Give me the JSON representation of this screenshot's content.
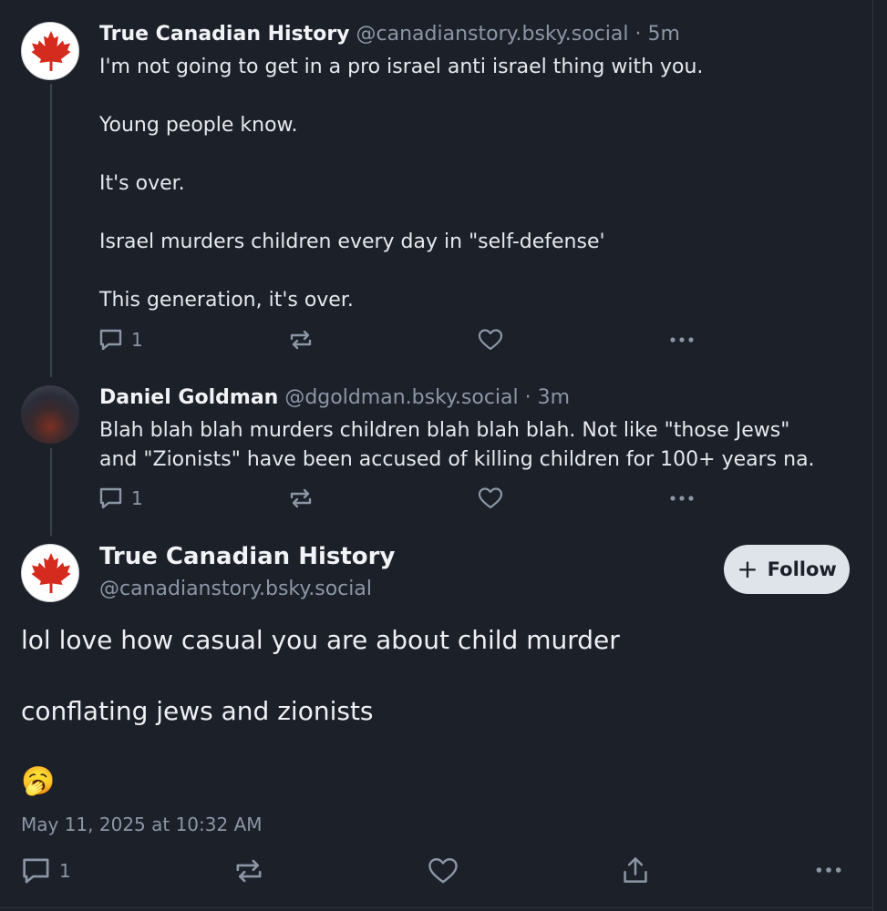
{
  "posts": [
    {
      "author": "True Canadian History",
      "handle": "@canadianstory.bsky.social",
      "separator": "·",
      "time": "5m",
      "body": "I'm not going to get in a pro israel anti israel thing with you.\n\nYoung people know.\n\nIt's over.\n\nIsrael murders children every day in \"self-defense'\n\nThis generation, it's over.",
      "reply_count": "1",
      "avatar_icon": "maple-leaf-icon"
    },
    {
      "author": "Daniel Goldman",
      "handle": "@dgoldman.bsky.social",
      "separator": "·",
      "time": "3m",
      "body": "Blah blah blah murders children blah blah blah. Not like \"those Jews\"\nand \"Zionists\" have been accused of killing children for 100+ years na.",
      "reply_count": "1"
    }
  ],
  "main_post": {
    "author": "True Canadian History",
    "handle": "@canadianstory.bsky.social",
    "follow_label": "Follow",
    "follow_plus": "+",
    "body": "lol love how casual you are about child murder\n\nconflating jews and zionists",
    "emoji": "🥱",
    "timestamp": "May 11, 2025 at 10:32 AM",
    "reply_count": "1"
  },
  "colors": {
    "background": "#1c2029",
    "text": "#e6e9ee",
    "muted": "#8d96a6",
    "maple_red": "#d52b1e",
    "follow_bg": "#dfe3ea"
  },
  "icons": {
    "reply": "reply-icon",
    "repost": "repost-icon",
    "like": "heart-icon",
    "more": "more-icon",
    "share": "share-icon"
  }
}
